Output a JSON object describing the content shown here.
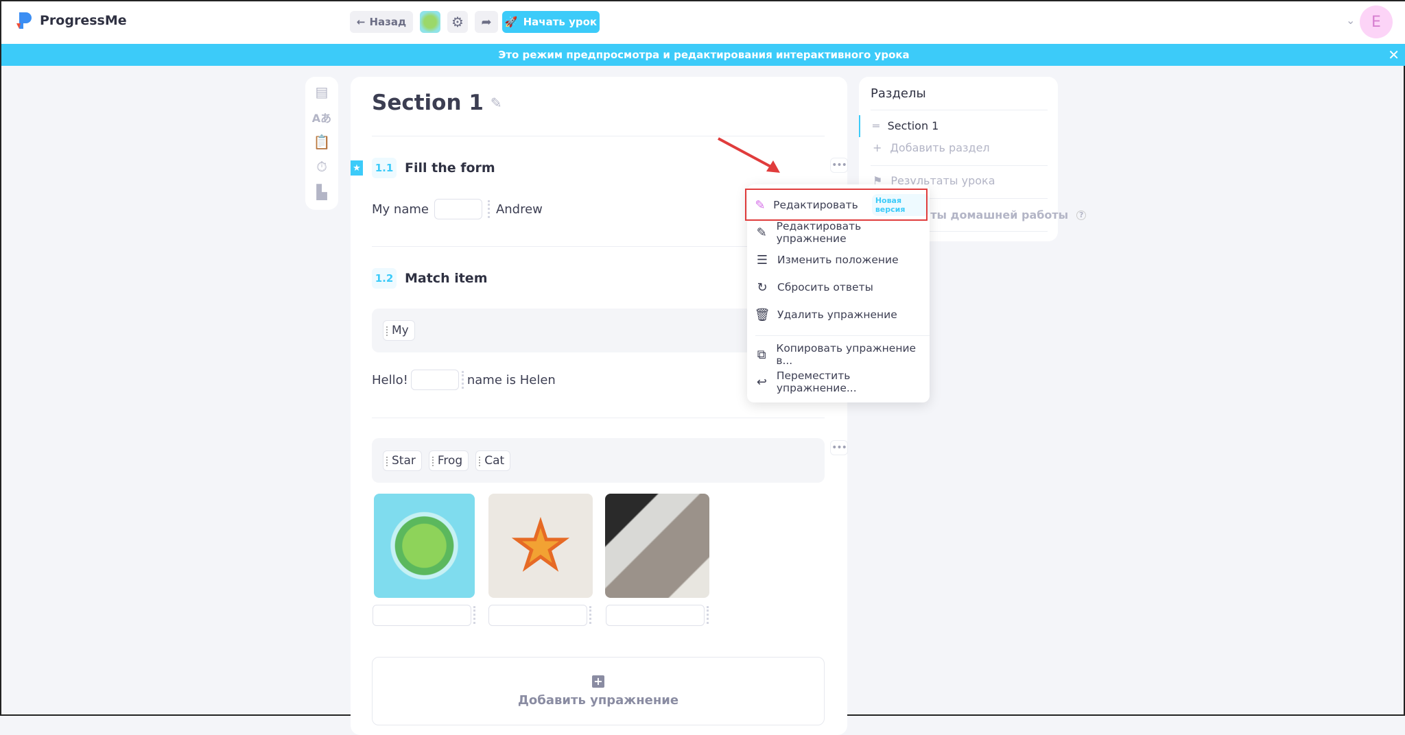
{
  "header": {
    "logo": "ProgressMe",
    "back": "Назад",
    "start": "Начать урок",
    "avatar_letter": "E"
  },
  "banner": {
    "text": "Это режим предпросмотра и редактирования интерактивного урока"
  },
  "section": {
    "title": "Section 1"
  },
  "exercises": [
    {
      "num": "1.1",
      "title": "Fill the form",
      "before": "My name",
      "after": "Andrew"
    },
    {
      "num": "1.2",
      "title": "Match item",
      "chip": "My",
      "before": "Hello!",
      "after": "name is Helen"
    }
  ],
  "match": {
    "chips": [
      "Star",
      "Frog",
      "Cat"
    ]
  },
  "add_exercise": "Добавить упражнение",
  "sections_panel": {
    "title": "Разделы",
    "items": [
      "Section 1"
    ],
    "add": "Добавить раздел",
    "results": "Результаты урока",
    "homework": "Результаты домашней работы"
  },
  "menu": {
    "items": [
      "Редактировать",
      "Редактировать упражнение",
      "Изменить положение",
      "Сбросить ответы",
      "Удалить упражнение",
      "Копировать упражнение в...",
      "Переместить упражнение..."
    ],
    "badge": "Новая версия"
  },
  "colors": {
    "accent": "#3ccbf9",
    "highlight": "#e03c3c"
  }
}
